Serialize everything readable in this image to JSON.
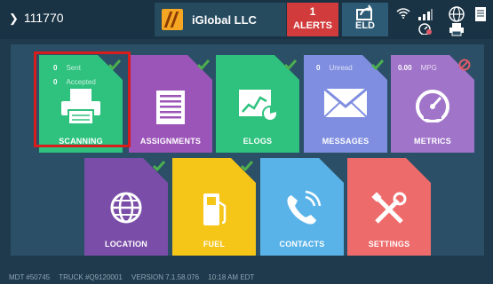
{
  "header": {
    "unit_id": "111770",
    "company_name": "iGlobal LLC",
    "alerts_count": "1",
    "alerts_label": "ALERTS",
    "eld_label": "ELD"
  },
  "tiles": {
    "scanning": {
      "label": "SCANNING",
      "sent_count": "0",
      "sent_label": "Sent",
      "accepted_count": "0",
      "accepted_label": "Accepted",
      "color": "#2ec27e"
    },
    "assignments": {
      "label": "ASSIGNMENTS",
      "color": "#9b54b8"
    },
    "elogs": {
      "label": "ELOGS",
      "color": "#2ec27e"
    },
    "messages": {
      "label": "MESSAGES",
      "unread_count": "0",
      "unread_label": "Unread",
      "color": "#7f8ee0"
    },
    "metrics": {
      "label": "METRICS",
      "mpg_value": "0.00",
      "mpg_label": "MPG",
      "color": "#a074c9"
    },
    "location": {
      "label": "LOCATION",
      "color": "#7a4ea8"
    },
    "fuel": {
      "label": "FUEL",
      "color": "#f5c518"
    },
    "contacts": {
      "label": "CONTACTS",
      "color": "#5ab3e8"
    },
    "settings": {
      "label": "SETTINGS",
      "color": "#ee6b6b"
    }
  },
  "footer": {
    "mdt": "MDT #50745",
    "truck": "TRUCK #Q9120001",
    "version": "VERSION 7.1.58.076",
    "time": "10:18 AM EDT"
  },
  "colors": {
    "check": "#4caf50",
    "highlight": "#d91c1c",
    "disabled": "#e05a6a"
  }
}
